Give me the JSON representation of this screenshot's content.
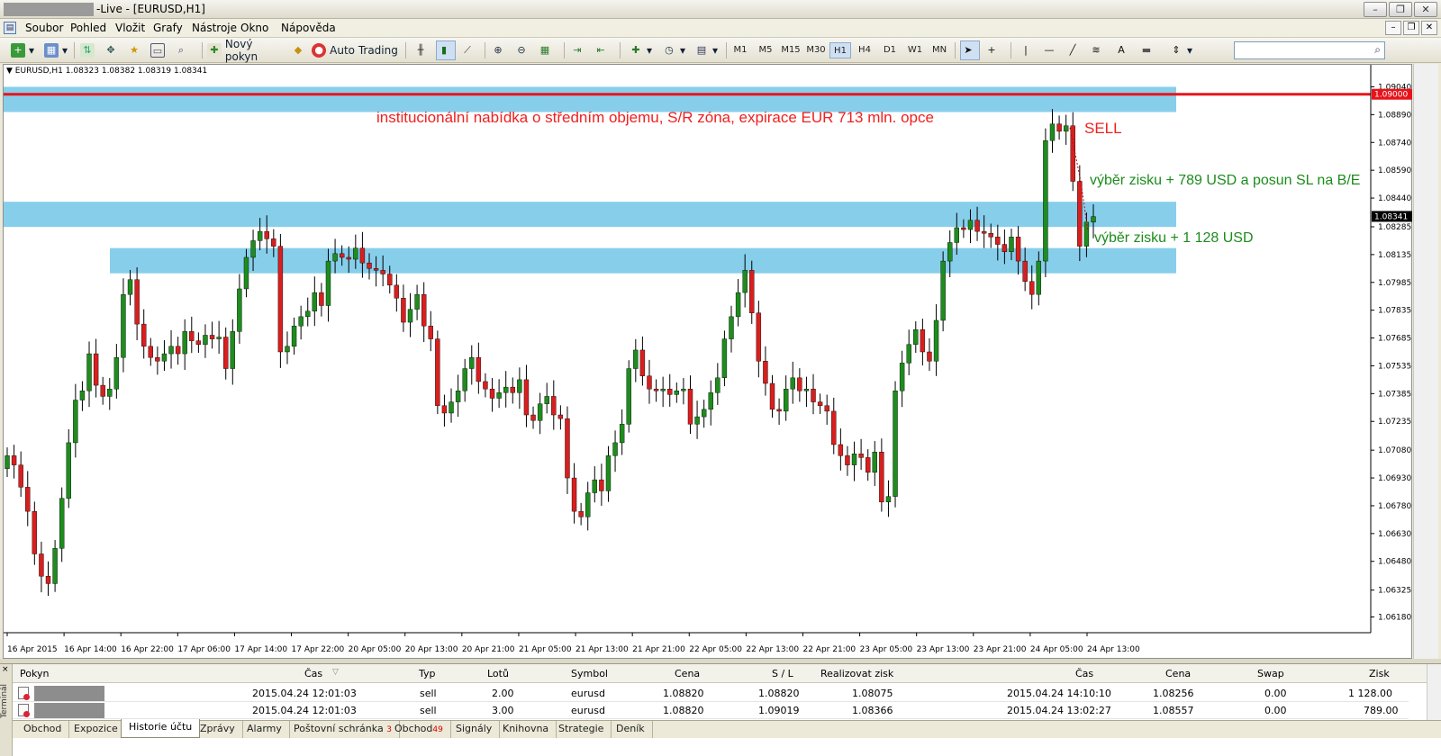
{
  "window": {
    "title": "-Live - [EURUSD,H1]"
  },
  "menu": [
    "Soubor",
    "Pohled",
    "Vložit",
    "Grafy",
    "Nástroje",
    "Okno",
    "Nápověda"
  ],
  "toolbar": {
    "new_order": "Nový pokyn",
    "auto_trading": "Auto Trading",
    "timeframes": [
      "M1",
      "M5",
      "M15",
      "M30",
      "H1",
      "H4",
      "D1",
      "W1",
      "MN"
    ],
    "active_timeframe": "H1",
    "search_placeholder": ""
  },
  "chart": {
    "label": "EURUSD,H1  1.08323 1.08382 1.08319 1.08341",
    "annotation_main": "institucionální nabídka o středním objemu, S/R zóna, expirace EUR 713 mln. opce",
    "annotation_sell": "SELL",
    "annotation_tp1": "výběr zisku + 789 USD a posun SL na B/E",
    "annotation_tp2": "výběr zisku + 1 128 USD",
    "colors": {
      "bull": "#1e8c1e",
      "bear": "#d81f1f",
      "zone": "#87ceeb",
      "line": "#e8131a",
      "annotation_main": "#f02020",
      "annotation_tp": "#1c8c1c"
    }
  },
  "chart_data": {
    "type": "candlestick",
    "symbol": "EURUSD",
    "timeframe": "H1",
    "current_price": "1.08341",
    "level_label": "1.09000",
    "y_ticks": [
      "1.09040",
      "1.08890",
      "1.08740",
      "1.08590",
      "1.08440",
      "1.08285",
      "1.08135",
      "1.07985",
      "1.07835",
      "1.07685",
      "1.07535",
      "1.07385",
      "1.07235",
      "1.07080",
      "1.06930",
      "1.06780",
      "1.06630",
      "1.06480",
      "1.06325",
      "1.06180"
    ],
    "ylim": [
      1.061,
      1.0912
    ],
    "x_ticks": [
      "16 Apr 2015",
      "16 Apr 14:00",
      "16 Apr 22:00",
      "17 Apr 06:00",
      "17 Apr 14:00",
      "17 Apr 22:00",
      "20 Apr 05:00",
      "20 Apr 13:00",
      "20 Apr 21:00",
      "21 Apr 05:00",
      "21 Apr 13:00",
      "21 Apr 21:00",
      "22 Apr 05:00",
      "22 Apr 13:00",
      "22 Apr 21:00",
      "23 Apr 05:00",
      "23 Apr 13:00",
      "23 Apr 21:00",
      "24 Apr 05:00",
      "24 Apr 13:00"
    ],
    "zones": [
      [
        1.0893,
        1.0904
      ],
      [
        1.0838,
        1.0842
      ],
      [
        1.0809,
        1.0817
      ]
    ],
    "horizontal_line": 1.09,
    "close_series": [
      1.0705,
      1.07,
      1.0688,
      1.0675,
      1.0652,
      1.064,
      1.0636,
      1.0655,
      1.0682,
      1.0712,
      1.0735,
      1.074,
      1.076,
      1.0743,
      1.0737,
      1.0741,
      1.0758,
      1.0792,
      1.08,
      1.0776,
      1.0764,
      1.0758,
      1.0756,
      1.076,
      1.0764,
      1.076,
      1.0772,
      1.0767,
      1.0765,
      1.077,
      1.0768,
      1.0769,
      1.0752,
      1.0772,
      1.0795,
      1.0812,
      1.0821,
      1.0826,
      1.0822,
      1.0818,
      1.0761,
      1.0764,
      1.0775,
      1.078,
      1.0783,
      1.0793,
      1.0786,
      1.081,
      1.0814,
      1.0812,
      1.0811,
      1.0817,
      1.0809,
      1.0806,
      1.0805,
      1.0803,
      1.0797,
      1.079,
      1.0777,
      1.0784,
      1.0792,
      1.0775,
      1.0768,
      1.0732,
      1.0728,
      1.0734,
      1.074,
      1.0752,
      1.0758,
      1.0745,
      1.0741,
      1.0736,
      1.0739,
      1.0742,
      1.0739,
      1.0746,
      1.0727,
      1.0724,
      1.0733,
      1.0737,
      1.0727,
      1.0725,
      1.0693,
      1.0675,
      1.0672,
      1.0685,
      1.0692,
      1.0686,
      1.0705,
      1.0712,
      1.0722,
      1.0752,
      1.0762,
      1.0748,
      1.0741,
      1.074,
      1.0741,
      1.0738,
      1.074,
      1.0741,
      1.0722,
      1.0726,
      1.073,
      1.0739,
      1.0747,
      1.0768,
      1.078,
      1.0793,
      1.0805,
      1.0782,
      1.0756,
      1.0744,
      1.073,
      1.0729,
      1.0741,
      1.0747,
      1.074,
      1.0741,
      1.0734,
      1.0732,
      1.0729,
      1.0711,
      1.0705,
      1.07,
      1.0706,
      1.0704,
      1.0696,
      1.0707,
      1.068,
      1.0683,
      1.074,
      1.0755,
      1.0765,
      1.0773,
      1.0761,
      1.0756,
      1.0778,
      1.081,
      1.082,
      1.0828,
      1.0827,
      1.0832,
      1.0826,
      1.0825,
      1.0823,
      1.0819,
      1.0815,
      1.0823,
      1.081,
      1.0799,
      1.0792,
      1.081,
      1.0875,
      1.0884,
      1.088,
      1.0883,
      1.0853,
      1.0818,
      1.0831,
      1.0834
    ]
  },
  "terminal": {
    "columns": [
      "Pokyn",
      "Čas",
      "Typ",
      "Lotů",
      "Symbol",
      "Cena",
      "S / L",
      "Realizovat zisk",
      "Čas",
      "Cena",
      "Swap",
      "Zisk"
    ],
    "rows": [
      {
        "time": "2015.04.24 12:01:03",
        "type": "sell",
        "lots": "2.00",
        "symbol": "eurusd",
        "price": "1.08820",
        "sl": "1.08820",
        "tp": "1.08075",
        "close_time": "2015.04.24 14:10:10",
        "close_price": "1.08256",
        "swap": "0.00",
        "profit": "1 128.00"
      },
      {
        "time": "2015.04.24 12:01:03",
        "type": "sell",
        "lots": "3.00",
        "symbol": "eurusd",
        "price": "1.08820",
        "sl": "1.09019",
        "tp": "1.08366",
        "close_time": "2015.04.24 13:02:27",
        "close_price": "1.08557",
        "swap": "0.00",
        "profit": "789.00"
      }
    ],
    "tabs": [
      {
        "label": "Obchod",
        "badge": ""
      },
      {
        "label": "Expozice",
        "badge": ""
      },
      {
        "label": "Historie účtu",
        "badge": ""
      },
      {
        "label": "Zprávy",
        "badge": ""
      },
      {
        "label": "Alarmy",
        "badge": ""
      },
      {
        "label": "Poštovní schránka",
        "badge": "3"
      },
      {
        "label": "Obchod",
        "badge": "49"
      },
      {
        "label": "Signály",
        "badge": ""
      },
      {
        "label": "Knihovna",
        "badge": ""
      },
      {
        "label": "Strategie",
        "badge": ""
      },
      {
        "label": "Deník",
        "badge": ""
      }
    ],
    "active_tab": "Historie účtu",
    "side_label": "Terminál"
  }
}
